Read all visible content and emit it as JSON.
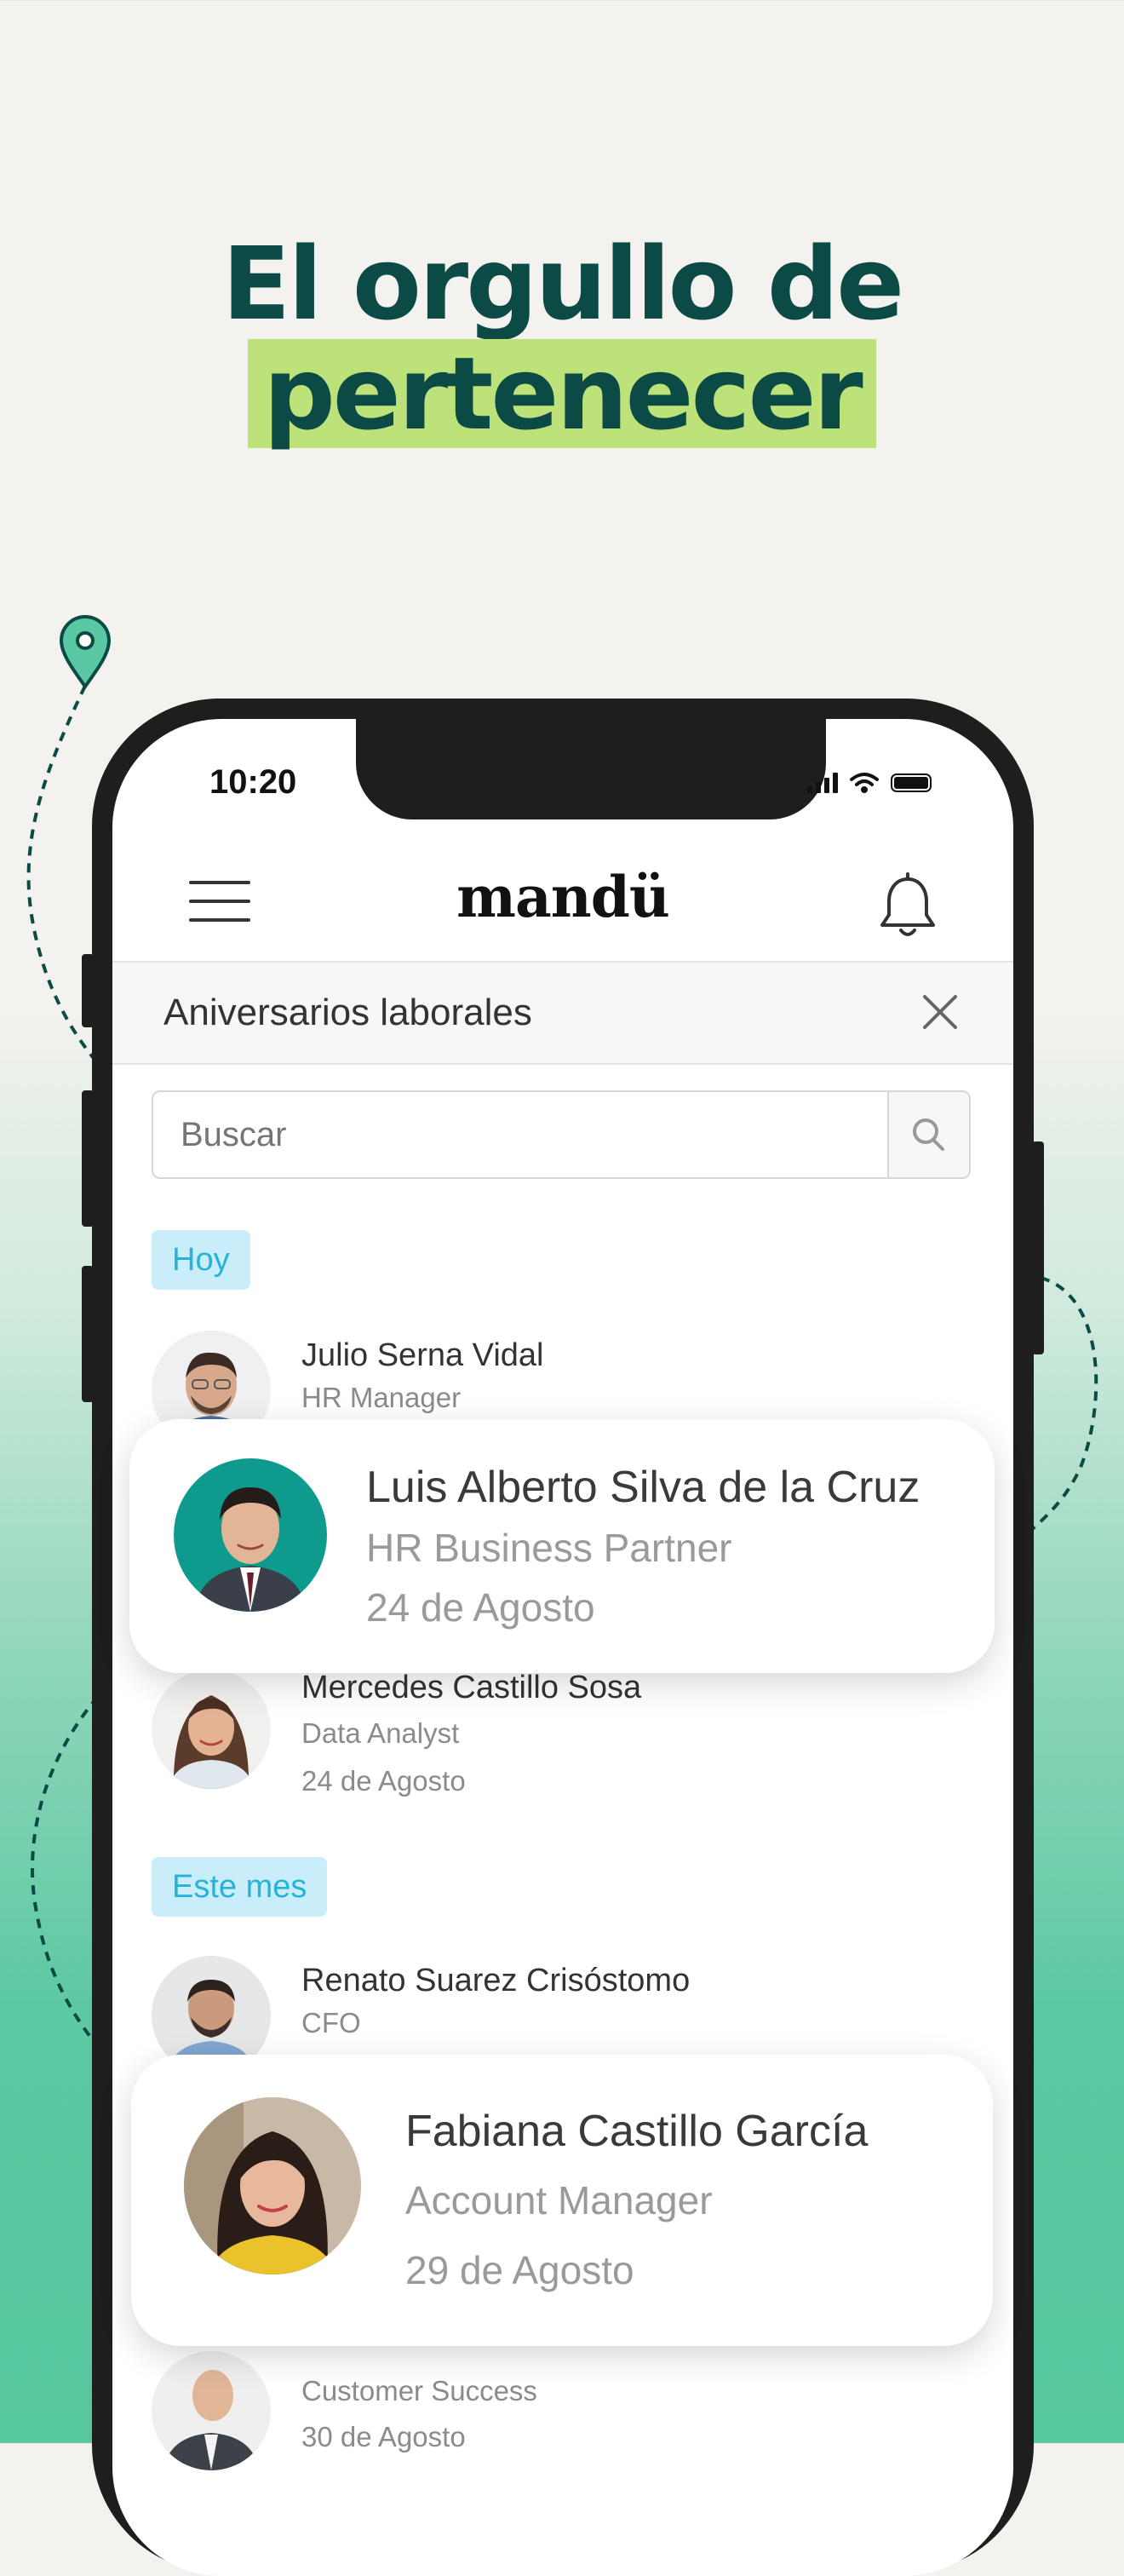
{
  "headline": {
    "line1": "El orgullo de",
    "line2": "pertenecer"
  },
  "status_bar": {
    "time": "10:20"
  },
  "app_bar": {
    "logo": "mandü",
    "menu_icon": "hamburger-icon",
    "notification_icon": "bell-icon"
  },
  "section": {
    "title": "Aniversarios laborales",
    "close_icon": "close-icon"
  },
  "search": {
    "placeholder": "Buscar",
    "icon": "search-icon"
  },
  "groups": [
    {
      "label": "Hoy"
    },
    {
      "label": "Este mes"
    }
  ],
  "list": {
    "julio": {
      "name": "Julio Serna Vidal",
      "role": "HR Manager"
    },
    "mercedes": {
      "name": "Mercedes Castillo Sosa",
      "role": "Data Analyst",
      "date": "24 de Agosto"
    },
    "renato": {
      "name": "Renato Suarez Crisóstomo",
      "role": "CFO"
    },
    "last": {
      "role": "Customer Success",
      "date": "30 de Agosto"
    }
  },
  "featured": [
    {
      "name": "Luis Alberto Silva de la Cruz",
      "role": "HR Business Partner",
      "date": "24 de Agosto"
    },
    {
      "name": "Fabiana Castillo García",
      "role": "Account Manager",
      "date": "29 de Agosto"
    }
  ],
  "colors": {
    "brand_dark": "#0b4a45",
    "highlight": "#bde27a",
    "pill_bg": "#c9eefa",
    "pill_text": "#27b3d8",
    "accent_green": "#57c79e"
  }
}
